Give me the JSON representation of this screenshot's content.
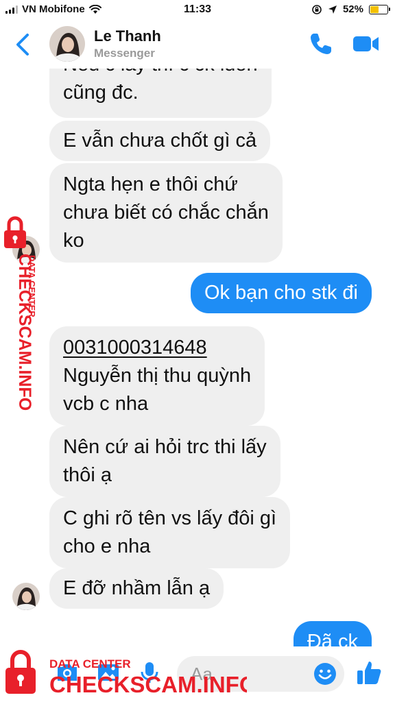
{
  "status_bar": {
    "carrier": "VN Mobifone",
    "time": "11:33",
    "battery_percent": "52%",
    "battery_level": 0.52,
    "icons": [
      "signal-icon",
      "wifi-icon",
      "rotation-lock-icon",
      "location-icon",
      "battery-icon"
    ]
  },
  "header": {
    "contact_name": "Le Thanh",
    "subtitle": "Messenger",
    "icons": [
      "back-chevron-icon",
      "phone-icon",
      "video-camera-icon"
    ],
    "accent_color": "#1e8df5"
  },
  "messages": [
    {
      "direction": "in",
      "lines": [
        "Nếu c lấy thì c ck luôn",
        "cũng đc."
      ]
    },
    {
      "direction": "in",
      "lines": [
        "E vẫn chưa chốt gì cả"
      ]
    },
    {
      "direction": "in",
      "lines": [
        "Ngta hẹn e thôi chứ",
        "chưa biết có chắc chắn",
        "ko"
      ]
    },
    {
      "direction": "out",
      "lines": [
        "Ok bạn cho stk đi"
      ]
    },
    {
      "direction": "in",
      "lines": [
        "0031000314648",
        "Nguyễn thị thu quỳnh",
        "vcb c nha"
      ]
    },
    {
      "direction": "in",
      "lines": [
        "Nên cứ ai hỏi trc thi lấy",
        "thôi ạ"
      ]
    },
    {
      "direction": "in",
      "lines": [
        "C ghi rõ tên vs lấy đôi gì",
        "cho e nha"
      ]
    },
    {
      "direction": "in",
      "lines": [
        "E đỡ nhầm lẫn ạ"
      ]
    },
    {
      "direction": "out",
      "lines": [
        "Đã ck"
      ]
    }
  ],
  "composer": {
    "placeholder": "Aa",
    "icons": [
      "camera-icon",
      "photo-icon",
      "microphone-icon",
      "emoji-icon",
      "thumbs-up-icon"
    ]
  },
  "watermark": {
    "brand": "CHECKSCAM.INFO",
    "tagline": "DATA CENTER",
    "color": "#e8202a",
    "icon": "padlock-icon"
  },
  "colors": {
    "incoming_bubble": "#efefef",
    "outgoing_bubble": "#1e8df5",
    "background": "#ffffff"
  }
}
